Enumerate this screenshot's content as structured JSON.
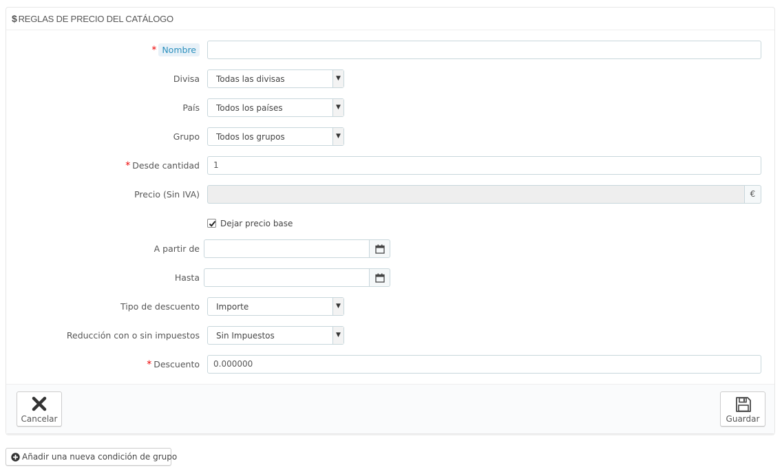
{
  "panel": {
    "dollar": "$",
    "title": "REGLAS DE PRECIO DEL CATÁLOGO"
  },
  "fields": {
    "nombre": {
      "label": "Nombre",
      "required": "*",
      "value": ""
    },
    "divisa": {
      "label": "Divisa",
      "selected": "Todas las divisas"
    },
    "pais": {
      "label": "País",
      "selected": "Todos los países"
    },
    "grupo": {
      "label": "Grupo",
      "selected": "Todos los grupos"
    },
    "desde_cantidad": {
      "label": "Desde cantidad",
      "required": "*",
      "value": "1"
    },
    "precio": {
      "label": "Precio (Sin IVA)",
      "value": "",
      "addon": "€"
    },
    "dejar_precio_base": {
      "label": "Dejar precio base",
      "checked": true
    },
    "a_partir_de": {
      "label": "A partir de",
      "value": ""
    },
    "hasta": {
      "label": "Hasta",
      "value": ""
    },
    "tipo_descuento": {
      "label": "Tipo de descuento",
      "selected": "Importe"
    },
    "reduccion": {
      "label": "Reducción con o sin impuestos",
      "selected": "Sin Impuestos"
    },
    "descuento": {
      "label": "Descuento",
      "required": "*",
      "value": "0.000000"
    }
  },
  "footer": {
    "cancel_label": "Cancelar",
    "save_label": "Guardar"
  },
  "add_group_label": "Añadir una nueva condición de grupo",
  "colors": {
    "required": "#ee0000",
    "hint_bg": "#e8f1f8",
    "hint_text": "#2a8fbd",
    "border": "#c7d6db"
  },
  "icons": {
    "cancel": "close-icon",
    "save": "floppy-disk-icon",
    "calendar": "calendar-icon",
    "add": "plus-circle-icon",
    "select": "chevron-down-icon",
    "check": "check-icon"
  }
}
